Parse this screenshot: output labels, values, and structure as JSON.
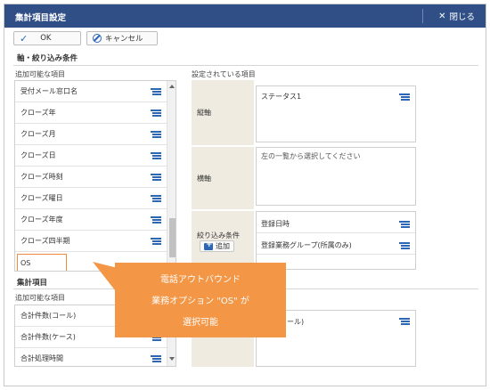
{
  "window": {
    "title": "集計項目設定",
    "close_label": "閉じる"
  },
  "toolbar": {
    "ok_label": "OK",
    "cancel_label": "キャンセル"
  },
  "axis_section": {
    "title": "軸・絞り込み条件",
    "available_label": "追加可能な項目",
    "configured_label": "設定されている項目",
    "available_items": [
      "受付メール窓口名",
      "クローズ年",
      "クローズ月",
      "クローズ日",
      "クローズ時刻",
      "クローズ曜日",
      "クローズ年度",
      "クローズ四半期",
      "OS"
    ],
    "vertical": {
      "label": "縦軸",
      "items": [
        "ステータス1"
      ]
    },
    "horizontal": {
      "label": "横軸",
      "placeholder": "左の一覧から選択してください"
    },
    "filter": {
      "label": "絞り込み条件",
      "add_label": "追加",
      "items": [
        "登録日時",
        "登録業務グループ(所属のみ)"
      ]
    }
  },
  "aggregate_section": {
    "title": "集計項目",
    "available_label": "追加可能な項目",
    "available_items": [
      "合計件数(コール)",
      "合計件数(ケース)",
      "合計処理時間"
    ],
    "configured_items": [
      "コール)"
    ]
  },
  "callout": {
    "lines": [
      "電話アウトバウンド",
      "業務オプション \"OS\" が",
      "選択可能"
    ]
  },
  "colors": {
    "titlebar": "#2f4f86",
    "accent": "#2d66b5",
    "callout": "#f39646",
    "label_bg": "#f0ebe1",
    "highlight": "#f08a3c"
  }
}
